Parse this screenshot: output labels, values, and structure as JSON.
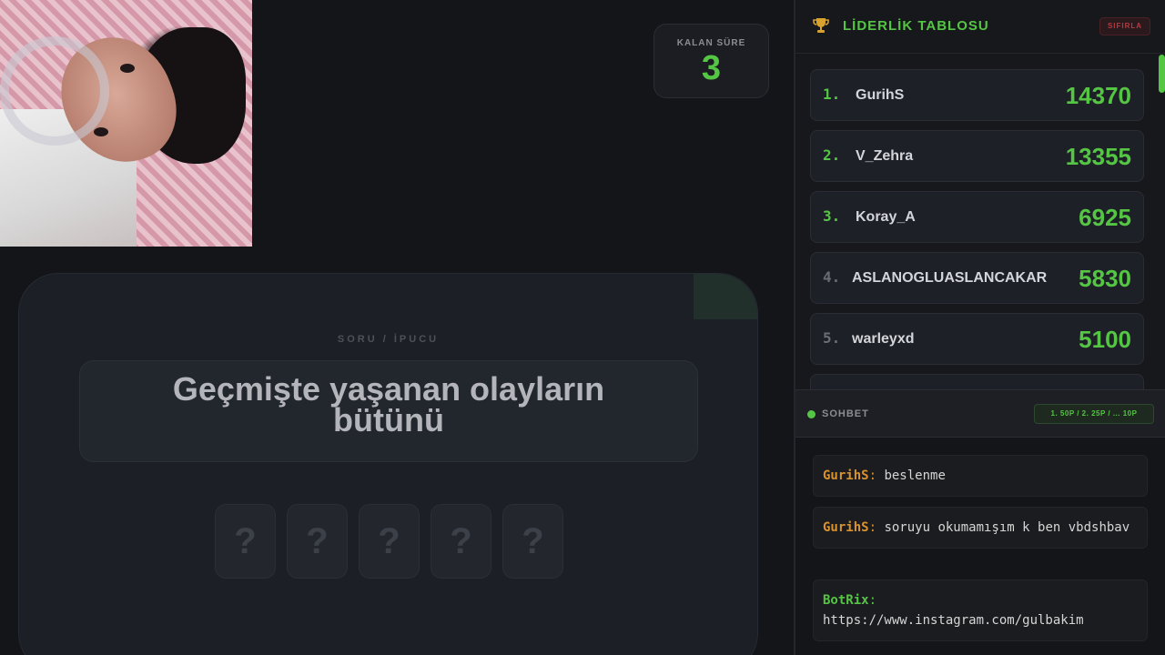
{
  "timer": {
    "label": "KALAN SÜRE",
    "value": "3"
  },
  "question": {
    "label": "SORU / İPUCU",
    "text_line1": "Geçmişte yaşanan olayların",
    "text_line2": "bütünü",
    "slots": [
      "?",
      "?",
      "?",
      "?",
      "?"
    ]
  },
  "leaderboard": {
    "title": "LİDERLİK TABLOSU",
    "reset_label": "SIFIRLA",
    "rows": [
      {
        "rank": "1.",
        "name": "GurihS",
        "score": "14370"
      },
      {
        "rank": "2.",
        "name": "V_Zehra",
        "score": "13355"
      },
      {
        "rank": "3.",
        "name": "Koray_A",
        "score": "6925"
      },
      {
        "rank": "4.",
        "name": "ASLANOGLUASLANCAKAR",
        "score": "5830"
      },
      {
        "rank": "5.",
        "name": "warleyxd",
        "score": "5100"
      }
    ]
  },
  "chat": {
    "title": "SOHBET",
    "points_badge": "1. 50P / 2. 25P / ... 10P",
    "messages": [
      {
        "user": "GurihS",
        "text": " beslenme"
      },
      {
        "user": "GurihS",
        "text": " soruyu okumamışım k ben vbdshbav"
      },
      {
        "user": "BotRix",
        "text": " https://www.instagram.com/gulbakim"
      }
    ]
  },
  "colors": {
    "accent": "#55c544",
    "danger": "#b53a3f",
    "username": "#d9922e"
  }
}
